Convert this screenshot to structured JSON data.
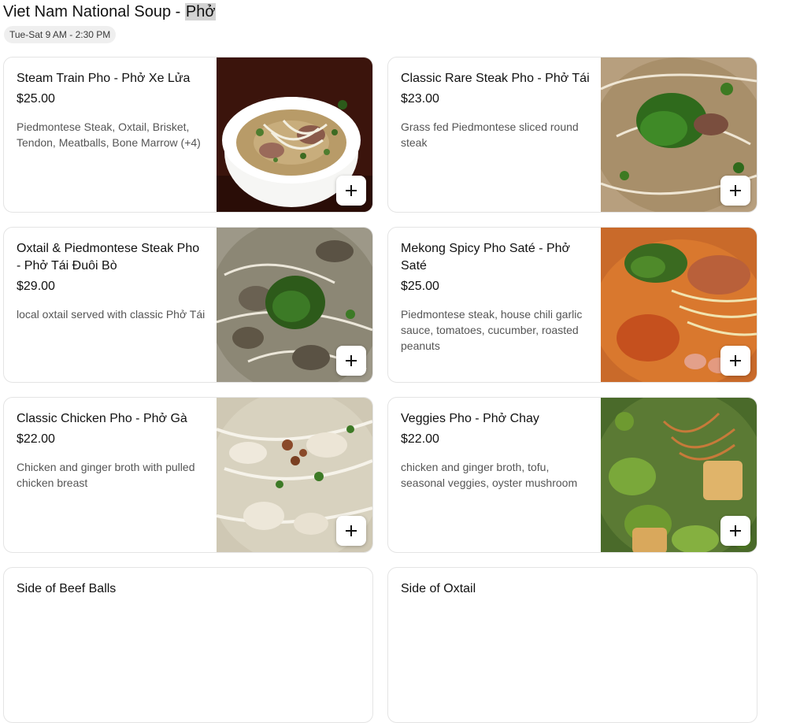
{
  "header": {
    "title_prefix": "Viet Nam National Soup - ",
    "title_highlight": "Phở",
    "hours": "Tue-Sat 9 AM - 2:30 PM"
  },
  "items": [
    {
      "name": "Steam Train Pho - Phở Xe Lửa",
      "price": "$25.00",
      "description": "Piedmontese Steak, Oxtail, Brisket, Tendon, Meatballs, Bone Marrow (+4)",
      "image": "bowl-of-pho-image"
    },
    {
      "name": "Classic Rare Steak Pho - Phở Tái",
      "price": "$23.00",
      "description": "Grass fed Piedmontese sliced round steak",
      "image": "rare-steak-pho-image"
    },
    {
      "name": "Oxtail & Piedmontese Steak Pho - Phở Tái Đuôi Bò",
      "price": "$29.00",
      "description": "local oxtail served with classic Phở Tái",
      "image": "oxtail-pho-image"
    },
    {
      "name": "Mekong Spicy Pho Saté - Phở Saté",
      "price": "$25.00",
      "description": "Piedmontese steak, house chili garlic sauce, tomatoes, cucumber, roasted peanuts",
      "image": "spicy-pho-image"
    },
    {
      "name": "Classic Chicken Pho - Phở Gà",
      "price": "$22.00",
      "description": "Chicken and ginger broth with pulled chicken breast",
      "image": "chicken-pho-image"
    },
    {
      "name": "Veggies Pho - Phở Chay",
      "price": "$22.00",
      "description": "chicken and ginger broth, tofu, seasonal veggies, oyster mushroom",
      "image": "veggie-pho-image"
    },
    {
      "name": "Side of Beef Balls",
      "price": "",
      "description": "",
      "image": ""
    },
    {
      "name": "Side of Oxtail",
      "price": "",
      "description": "",
      "image": ""
    }
  ]
}
